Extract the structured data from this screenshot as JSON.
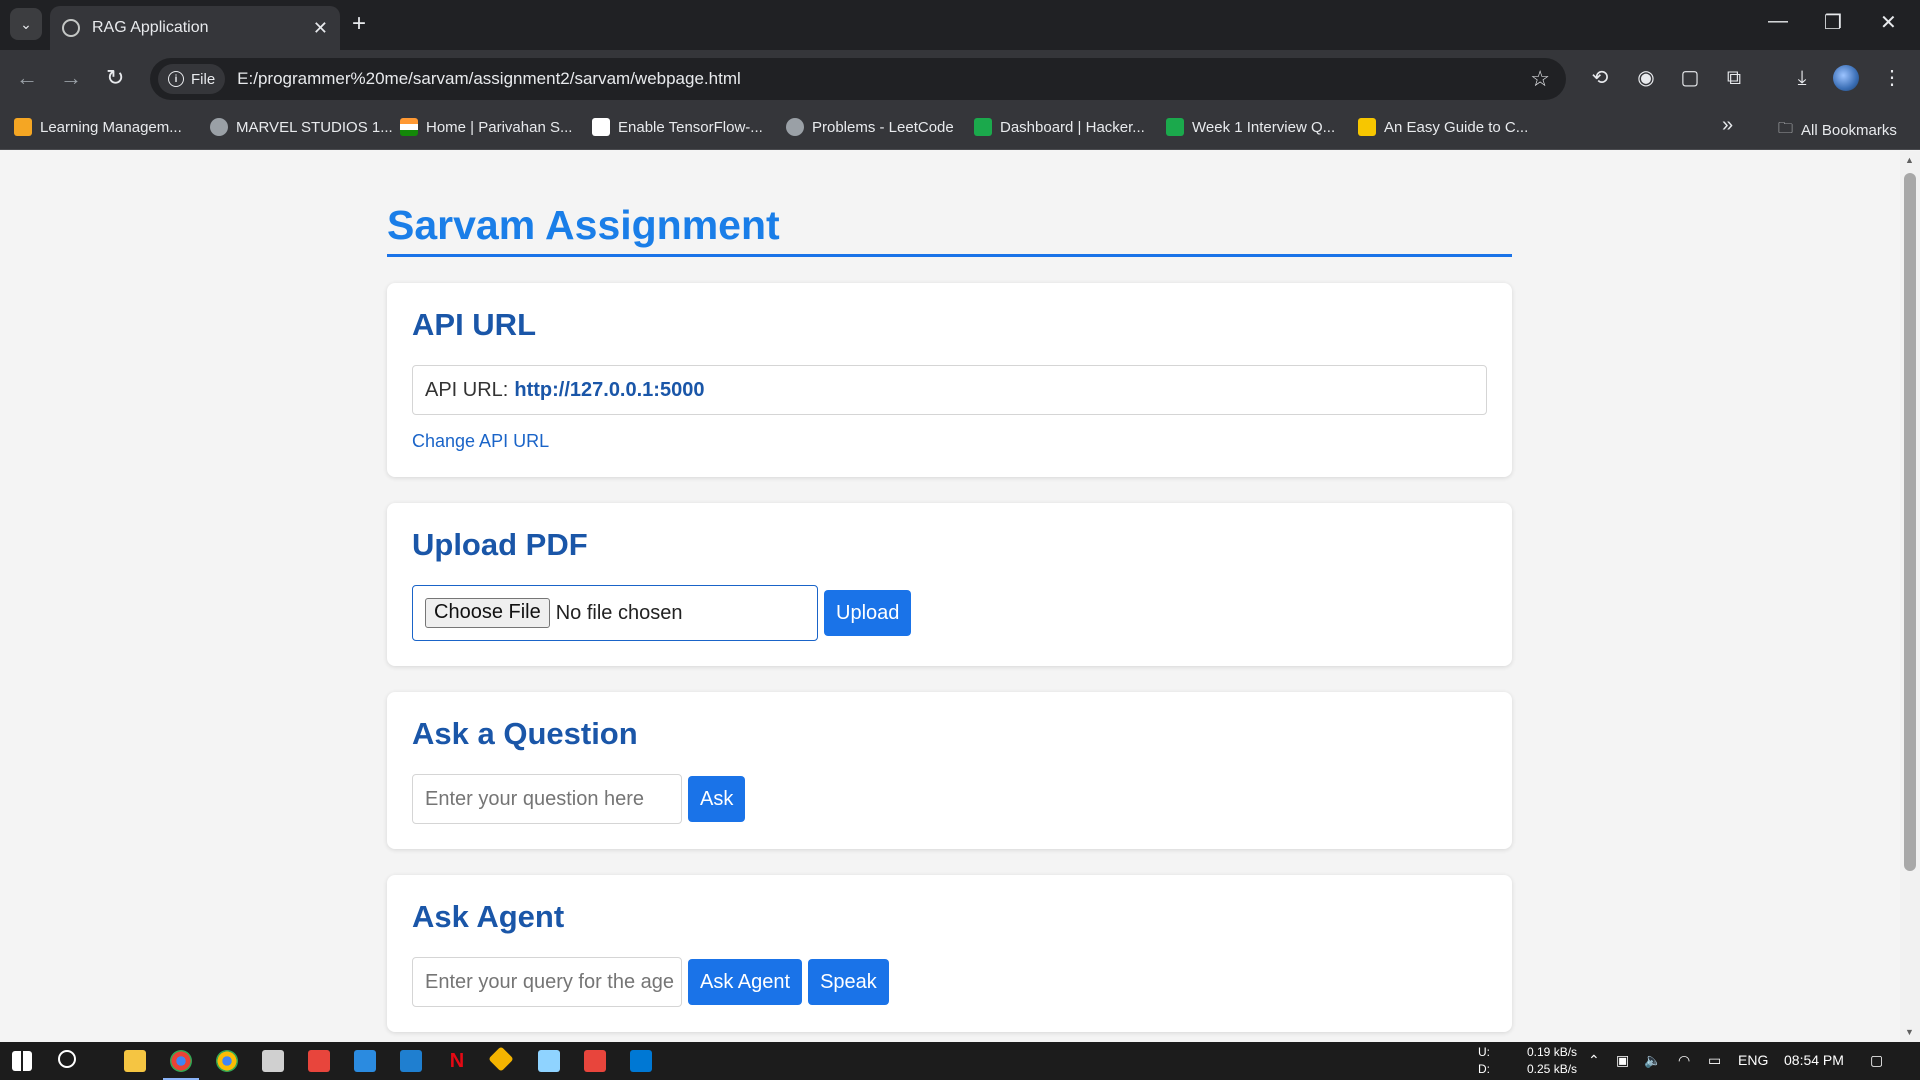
{
  "browser": {
    "tab_title": "RAG Application",
    "tab_close": "✕",
    "new_tab": "+",
    "url_chip": "File",
    "url": "E:/programmer%20me/sarvam/assignment2/sarvam/webpage.html",
    "bookmarks": [
      {
        "label": "Learning Managem...",
        "color": "#f5a623"
      },
      {
        "label": "MARVEL STUDIOS 1...",
        "color": "#9aa0a6"
      },
      {
        "label": "Home | Parivahan S...",
        "color": "#ff9933"
      },
      {
        "label": "Enable TensorFlow-...",
        "color": "#ffffff"
      },
      {
        "label": "Problems - LeetCode",
        "color": "#9aa0a6"
      },
      {
        "label": "Dashboard | Hacker...",
        "color": "#1ba94c"
      },
      {
        "label": "Week 1 Interview Q...",
        "color": "#1ba94c"
      },
      {
        "label": "An Easy Guide to C...",
        "color": "#f7c600"
      }
    ],
    "all_bookmarks": "All Bookmarks",
    "more_bookmarks": "»"
  },
  "page": {
    "title": "Sarvam Assignment",
    "api_section": {
      "heading": "API URL",
      "label": "API URL:",
      "value": "http://127.0.0.1:5000",
      "change_link": "Change API URL"
    },
    "upload_section": {
      "heading": "Upload PDF",
      "choose_button": "Choose File",
      "file_status": "No file chosen",
      "upload_button": "Upload"
    },
    "question_section": {
      "heading": "Ask a Question",
      "placeholder": "Enter your question here",
      "ask_button": "Ask"
    },
    "agent_section": {
      "heading": "Ask Agent",
      "placeholder": "Enter your query for the age",
      "ask_agent_button": "Ask Agent",
      "speak_button": "Speak"
    }
  },
  "taskbar": {
    "net_up_label": "U:",
    "net_down_label": "D:",
    "net_up": "0.19 kB/s",
    "net_down": "0.25 kB/s",
    "language": "ENG",
    "time": "08:54 PM"
  },
  "colors": {
    "accent": "#1a73e8",
    "heading": "#1a56a8"
  }
}
